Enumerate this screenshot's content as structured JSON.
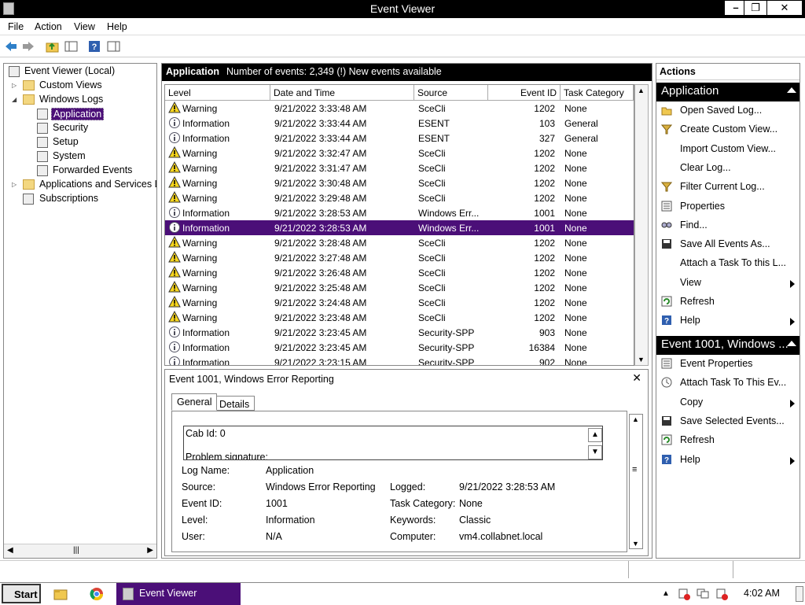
{
  "window": {
    "title": "Event Viewer",
    "min": "–",
    "max": "❐",
    "close": "✕"
  },
  "menu": [
    "File",
    "Action",
    "View",
    "Help"
  ],
  "tree": {
    "root": "Event Viewer (Local)",
    "custom_views": "Custom Views",
    "windows_logs": "Windows Logs",
    "logs": [
      "Application",
      "Security",
      "Setup",
      "System",
      "Forwarded Events"
    ],
    "app_services": "Applications and Services Lo",
    "subscriptions": "Subscriptions"
  },
  "log_header": {
    "name": "Application",
    "info": "Number of events: 2,349 (!) New events available"
  },
  "columns": [
    "Level",
    "Date and Time",
    "Source",
    "Event ID",
    "Task Category"
  ],
  "events": [
    {
      "level": "Warning",
      "date": "9/21/2022 3:33:48 AM",
      "source": "SceCli",
      "id": "1202",
      "task": "None"
    },
    {
      "level": "Information",
      "date": "9/21/2022 3:33:44 AM",
      "source": "ESENT",
      "id": "103",
      "task": "General"
    },
    {
      "level": "Information",
      "date": "9/21/2022 3:33:44 AM",
      "source": "ESENT",
      "id": "327",
      "task": "General"
    },
    {
      "level": "Warning",
      "date": "9/21/2022 3:32:47 AM",
      "source": "SceCli",
      "id": "1202",
      "task": "None"
    },
    {
      "level": "Warning",
      "date": "9/21/2022 3:31:47 AM",
      "source": "SceCli",
      "id": "1202",
      "task": "None"
    },
    {
      "level": "Warning",
      "date": "9/21/2022 3:30:48 AM",
      "source": "SceCli",
      "id": "1202",
      "task": "None"
    },
    {
      "level": "Warning",
      "date": "9/21/2022 3:29:48 AM",
      "source": "SceCli",
      "id": "1202",
      "task": "None"
    },
    {
      "level": "Information",
      "date": "9/21/2022 3:28:53 AM",
      "source": "Windows Err...",
      "id": "1001",
      "task": "None"
    },
    {
      "level": "Information",
      "date": "9/21/2022 3:28:53 AM",
      "source": "Windows Err...",
      "id": "1001",
      "task": "None"
    },
    {
      "level": "Warning",
      "date": "9/21/2022 3:28:48 AM",
      "source": "SceCli",
      "id": "1202",
      "task": "None"
    },
    {
      "level": "Warning",
      "date": "9/21/2022 3:27:48 AM",
      "source": "SceCli",
      "id": "1202",
      "task": "None"
    },
    {
      "level": "Warning",
      "date": "9/21/2022 3:26:48 AM",
      "source": "SceCli",
      "id": "1202",
      "task": "None"
    },
    {
      "level": "Warning",
      "date": "9/21/2022 3:25:48 AM",
      "source": "SceCli",
      "id": "1202",
      "task": "None"
    },
    {
      "level": "Warning",
      "date": "9/21/2022 3:24:48 AM",
      "source": "SceCli",
      "id": "1202",
      "task": "None"
    },
    {
      "level": "Warning",
      "date": "9/21/2022 3:23:48 AM",
      "source": "SceCli",
      "id": "1202",
      "task": "None"
    },
    {
      "level": "Information",
      "date": "9/21/2022 3:23:45 AM",
      "source": "Security-SPP",
      "id": "903",
      "task": "None"
    },
    {
      "level": "Information",
      "date": "9/21/2022 3:23:45 AM",
      "source": "Security-SPP",
      "id": "16384",
      "task": "None"
    },
    {
      "level": "Information",
      "date": "9/21/2022 3:23:15 AM",
      "source": "Security-SPP",
      "id": "902",
      "task": "None"
    }
  ],
  "selected_index": 8,
  "detail": {
    "title": "Event 1001, Windows Error Reporting",
    "tabs": [
      "General",
      "Details"
    ],
    "description": [
      "Cab Id: 0",
      "Problem signature:"
    ],
    "labels": {
      "log_name": "Log Name:",
      "source": "Source:",
      "event_id": "Event ID:",
      "level": "Level:",
      "user": "User:",
      "logged": "Logged:",
      "task": "Task Category:",
      "keywords": "Keywords:",
      "computer": "Computer:"
    },
    "values": {
      "log_name": "Application",
      "source": "Windows Error Reporting",
      "event_id": "1001",
      "level": "Information",
      "user": "N/A",
      "logged": "9/21/2022 3:28:53 AM",
      "task": "None",
      "keywords": "Classic",
      "computer": "vm4.collabnet.local"
    }
  },
  "actions": {
    "header": "Actions",
    "section1": "Application",
    "items1": [
      {
        "label": "Open Saved Log...",
        "icon": "folder-open-icon"
      },
      {
        "label": "Create Custom View...",
        "icon": "filter-icon"
      },
      {
        "label": "Import Custom View...",
        "icon": ""
      },
      {
        "label": "Clear Log...",
        "icon": ""
      },
      {
        "label": "Filter Current Log...",
        "icon": "filter-icon"
      },
      {
        "label": "Properties",
        "icon": "properties-icon"
      },
      {
        "label": "Find...",
        "icon": "find-icon"
      },
      {
        "label": "Save All Events As...",
        "icon": "save-icon"
      },
      {
        "label": "Attach a Task To this L...",
        "icon": ""
      },
      {
        "label": "View",
        "icon": "",
        "submenu": true
      },
      {
        "label": "Refresh",
        "icon": "refresh-icon"
      },
      {
        "label": "Help",
        "icon": "help-icon",
        "submenu": true
      }
    ],
    "section2": "Event 1001, Windows ...",
    "items2": [
      {
        "label": "Event Properties",
        "icon": "properties-icon"
      },
      {
        "label": "Attach Task To This Ev...",
        "icon": "task-icon"
      },
      {
        "label": "Copy",
        "icon": "copy-icon",
        "submenu": true
      },
      {
        "label": "Save Selected Events...",
        "icon": "save-icon"
      },
      {
        "label": "Refresh",
        "icon": "refresh-icon"
      },
      {
        "label": "Help",
        "icon": "help-icon",
        "submenu": true
      }
    ]
  },
  "taskbar": {
    "start": "Start",
    "active_window": "Event Viewer",
    "clock": "4:02 AM"
  }
}
